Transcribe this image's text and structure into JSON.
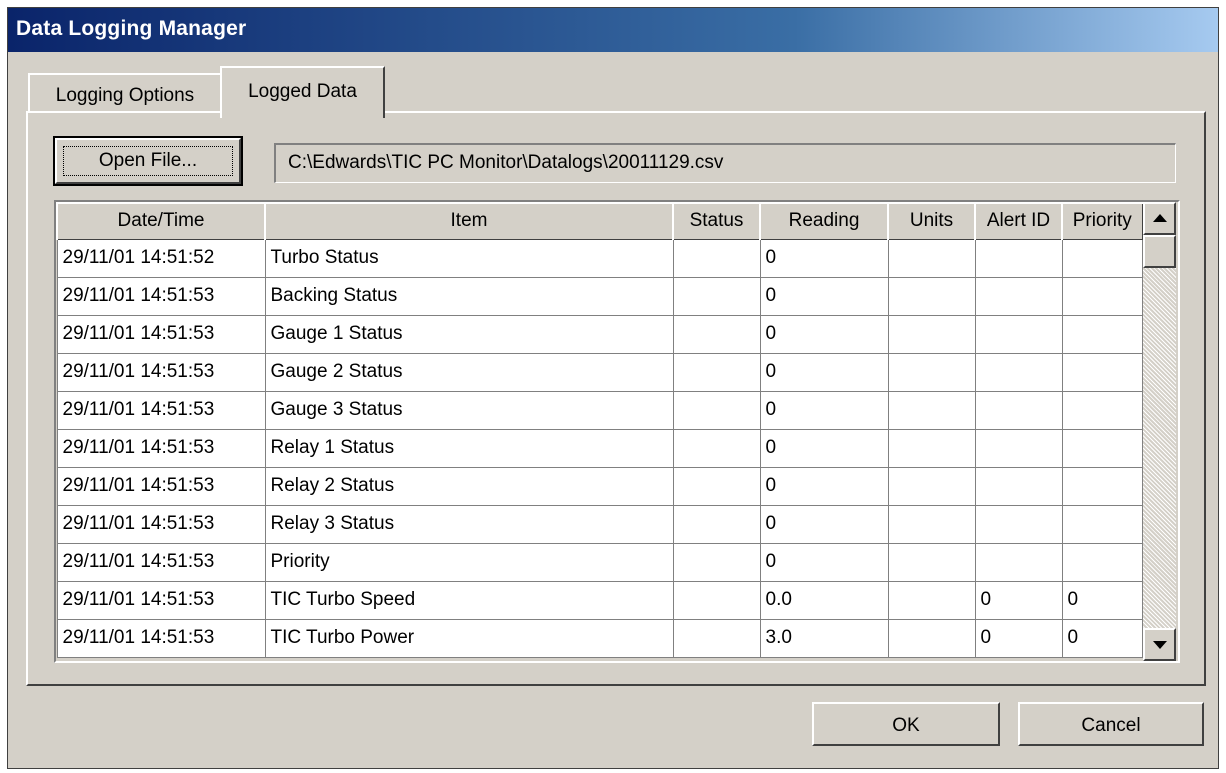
{
  "window": {
    "title": "Data Logging Manager"
  },
  "tabs": [
    {
      "label": "Logging Options",
      "active": false
    },
    {
      "label": "Logged Data",
      "active": true
    }
  ],
  "open_file_button": "Open File...",
  "file_path": "C:\\Edwards\\TIC PC Monitor\\Datalogs\\20011129.csv",
  "table": {
    "columns": [
      "Date/Time",
      "Item",
      "Status",
      "Reading",
      "Units",
      "Alert ID",
      "Priority"
    ],
    "rows": [
      [
        "29/11/01 14:51:52",
        "Turbo Status",
        "",
        "0",
        "",
        "",
        ""
      ],
      [
        "29/11/01 14:51:53",
        "Backing Status",
        "",
        "0",
        "",
        "",
        ""
      ],
      [
        "29/11/01 14:51:53",
        "Gauge 1 Status",
        "",
        "0",
        "",
        "",
        ""
      ],
      [
        "29/11/01 14:51:53",
        "Gauge 2 Status",
        "",
        "0",
        "",
        "",
        ""
      ],
      [
        "29/11/01 14:51:53",
        "Gauge 3 Status",
        "",
        "0",
        "",
        "",
        ""
      ],
      [
        "29/11/01 14:51:53",
        "Relay 1 Status",
        "",
        "0",
        "",
        "",
        ""
      ],
      [
        "29/11/01 14:51:53",
        "Relay 2 Status",
        "",
        "0",
        "",
        "",
        ""
      ],
      [
        "29/11/01 14:51:53",
        "Relay 3 Status",
        "",
        "0",
        "",
        "",
        ""
      ],
      [
        "29/11/01 14:51:53",
        "Priority",
        "",
        "0",
        "",
        "",
        ""
      ],
      [
        "29/11/01 14:51:53",
        "TIC Turbo Speed",
        "",
        "0.0",
        "",
        "0",
        "0"
      ],
      [
        "29/11/01 14:51:53",
        "TIC Turbo Power",
        "",
        "3.0",
        "",
        "0",
        "0"
      ]
    ]
  },
  "buttons": {
    "ok": "OK",
    "cancel": "Cancel"
  }
}
